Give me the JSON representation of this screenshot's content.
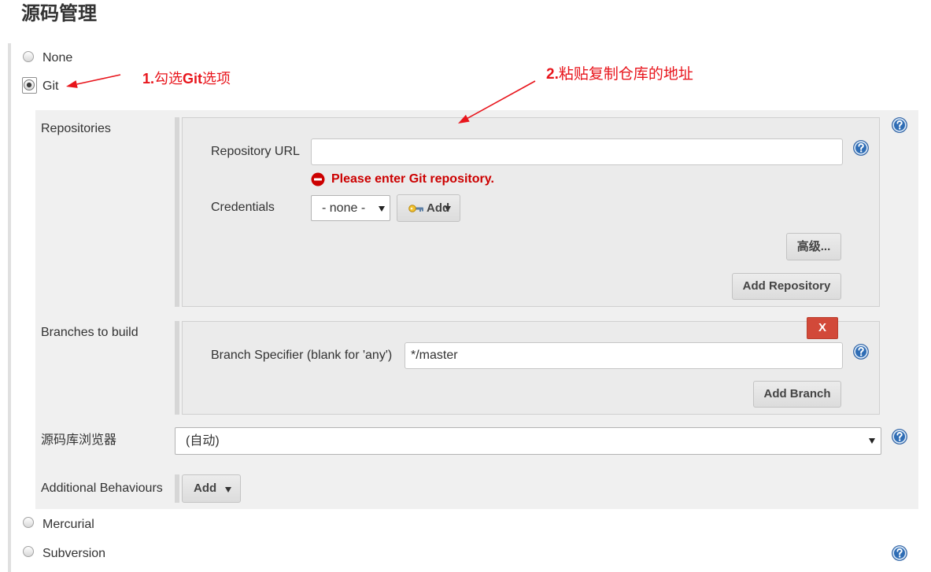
{
  "section": {
    "title": "源码管理"
  },
  "scm_options": [
    {
      "label": "None",
      "selected": false
    },
    {
      "label": "Git",
      "selected": true
    },
    {
      "label": "Mercurial",
      "selected": false
    },
    {
      "label": "Subversion",
      "selected": false
    }
  ],
  "annotations": [
    {
      "number": "1.",
      "before": "勾选",
      "emphasis": "Git",
      "after": "选项"
    },
    {
      "number": "2.",
      "text": "粘贴复制仓库的地址"
    }
  ],
  "git": {
    "repositories": {
      "label": "Repositories",
      "url_label": "Repository URL",
      "url_value": "",
      "error_message": "Please enter Git repository.",
      "credentials_label": "Credentials",
      "credentials_selected": "- none -",
      "add_credentials_label": "Add",
      "advanced_label": "高级...",
      "add_repository_label": "Add Repository"
    },
    "branches": {
      "label": "Branches to build",
      "delete_label": "X",
      "specifier_label": "Branch Specifier (blank for 'any')",
      "specifier_value": "*/master",
      "add_branch_label": "Add Branch"
    },
    "repository_browser": {
      "label": "源码库浏览器",
      "selected": "(自动)"
    },
    "additional_behaviours": {
      "label": "Additional Behaviours",
      "add_label": "Add"
    }
  },
  "icons": {
    "help": "help-icon",
    "error": "error-icon",
    "credentials": "key-icon",
    "dropdown": "chevron-down-icon",
    "annotation_arrow": "arrow-icon"
  },
  "colors": {
    "annotation": "#e8151c",
    "error": "#cc0000",
    "delete": "#d24939",
    "help": "#2f6db5"
  }
}
